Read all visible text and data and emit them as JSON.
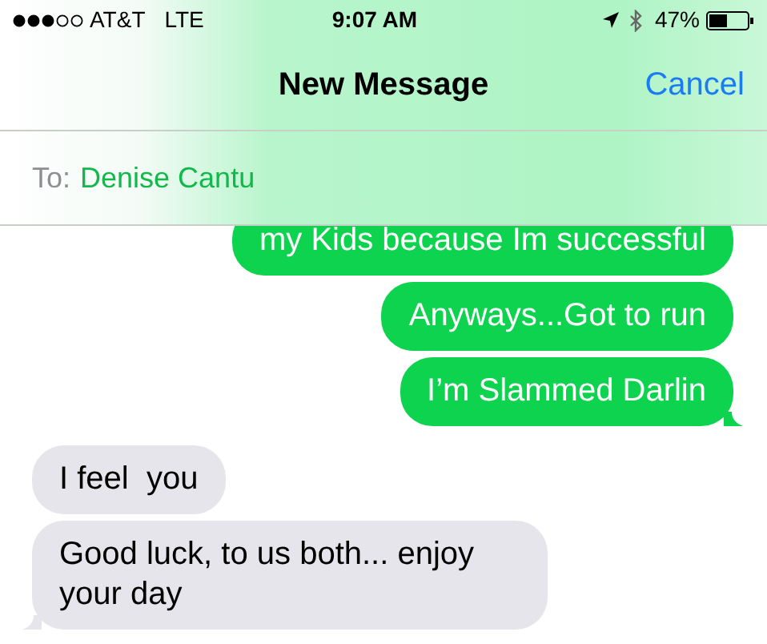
{
  "status_bar": {
    "carrier": "AT&T",
    "network": "LTE",
    "time": "9:07 AM",
    "battery": "47%"
  },
  "nav": {
    "title": "New Message",
    "action": "Cancel"
  },
  "recipient": {
    "label": "To:",
    "name": "Denise Cantu"
  },
  "messages": [
    {
      "kind": "sent",
      "text": "my Kids because Im successful"
    },
    {
      "kind": "sent",
      "text": "Anyways...Got to run"
    },
    {
      "kind": "sent",
      "text": "I’m Slammed Darlin"
    },
    {
      "kind": "received",
      "text": "I feel  you"
    },
    {
      "kind": "received",
      "text": "Good luck, to us both... enjoy your day"
    }
  ]
}
